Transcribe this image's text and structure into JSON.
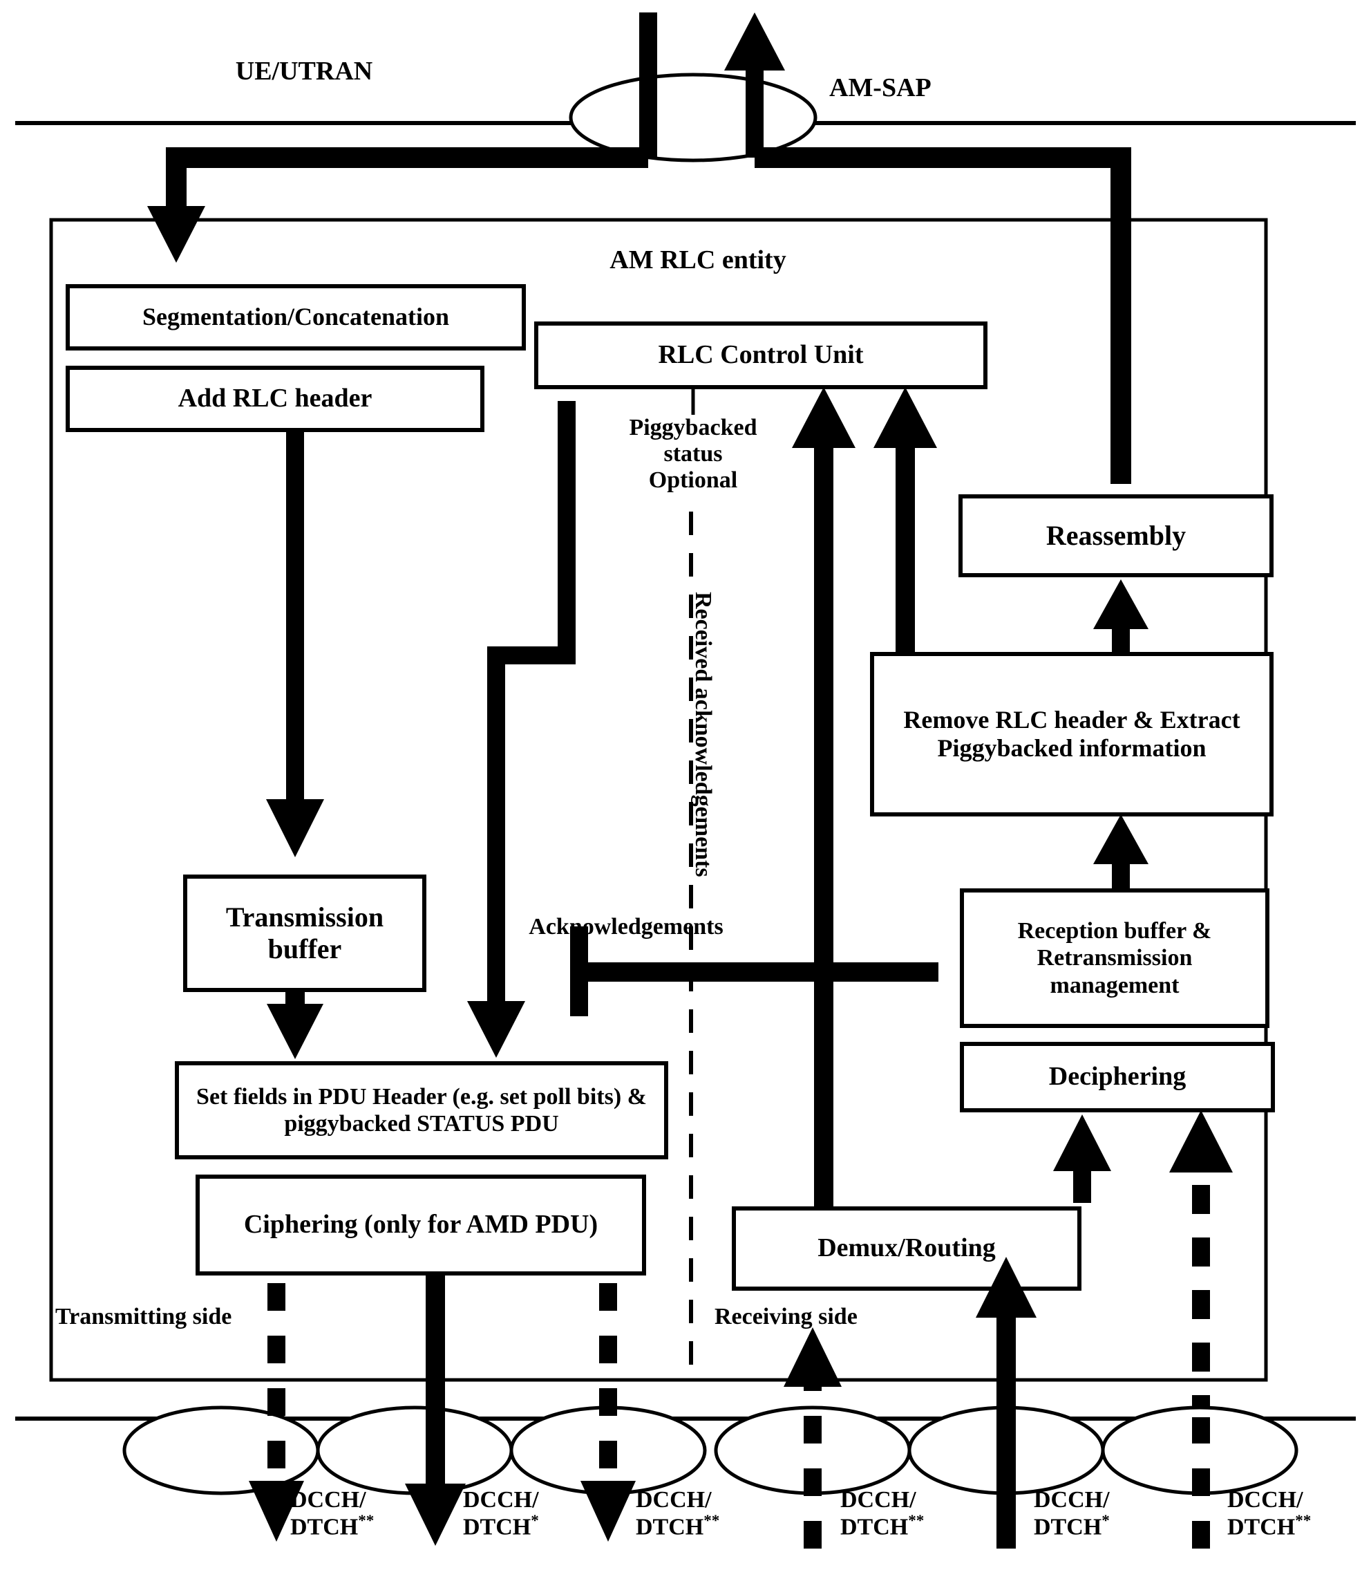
{
  "diagram": {
    "title_center": "AM RLC entity",
    "left_plane_label": "UE/UTRAN",
    "sap_label": "AM-SAP",
    "side_labels": {
      "transmitting": "Transmitting side",
      "receiving": "Receiving side"
    }
  },
  "boxes": {
    "segmentation": "Segmentation/Concatenation",
    "add_header": "Add RLC header",
    "control_unit": "RLC Control Unit",
    "transmission_buffer": "Transmission\nbuffer",
    "set_fields": "Set fields in PDU Header (e.g. set poll bits) & piggybacked STATUS PDU",
    "ciphering": "Ciphering (only for AMD PDU)",
    "reassembly": "Reassembly",
    "remove_header": "Remove RLC header & Extract Piggybacked information",
    "reception_buffer": "Reception buffer & Retransmission management",
    "deciphering": "Deciphering",
    "demux_routing": "Demux/Routing"
  },
  "annotations": {
    "piggybacked": "Piggybacked\nstatus\nOptional",
    "acknowledgements": "Acknowledgements",
    "received_acknowledgements": "Received\nacknowledgements"
  },
  "channels": [
    {
      "id": "ch1",
      "line1": "DCCH/",
      "line2": "DTCH",
      "marker": "**",
      "direction": "down",
      "style": "dashed"
    },
    {
      "id": "ch2",
      "line1": "DCCH/",
      "line2": "DTCH",
      "marker": "*",
      "direction": "down",
      "style": "solid"
    },
    {
      "id": "ch3",
      "line1": "DCCH/",
      "line2": "DTCH",
      "marker": "**",
      "direction": "down",
      "style": "dashed"
    },
    {
      "id": "ch4",
      "line1": "DCCH/",
      "line2": "DTCH",
      "marker": "**",
      "direction": "up",
      "style": "dashed"
    },
    {
      "id": "ch5",
      "line1": "DCCH/",
      "line2": "DTCH",
      "marker": "*",
      "direction": "up",
      "style": "solid"
    },
    {
      "id": "ch6",
      "line1": "DCCH/",
      "line2": "DTCH",
      "marker": "**",
      "direction": "up",
      "style": "dashed"
    }
  ],
  "colors": {
    "ink": "#000000",
    "paper": "#ffffff"
  }
}
